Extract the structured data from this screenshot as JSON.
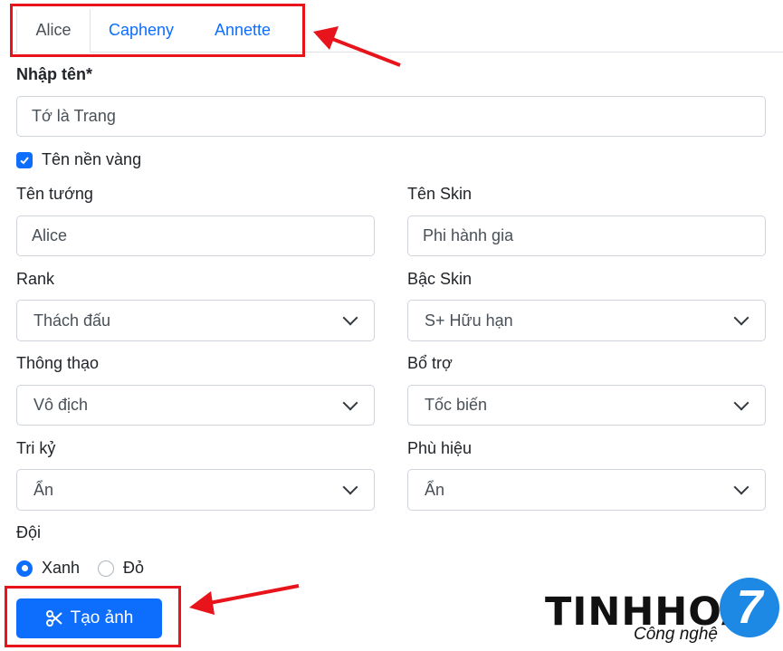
{
  "tabs": [
    {
      "label": "Alice",
      "active": true
    },
    {
      "label": "Capheny",
      "active": false
    },
    {
      "label": "Annette",
      "active": false
    }
  ],
  "name_field": {
    "label": "Nhập tên*",
    "value": "Tớ là Trang"
  },
  "gold_name": {
    "label": "Tên nền vàng",
    "checked": true
  },
  "hero": {
    "label": "Tên tướng",
    "value": "Alice"
  },
  "skin_name": {
    "label": "Tên Skin",
    "value": "Phi hành gia"
  },
  "rank": {
    "label": "Rank",
    "selected": "Thách đấu"
  },
  "skin_tier": {
    "label": "Bậc Skin",
    "selected": "S+ Hữu hạn"
  },
  "mastery": {
    "label": "Thông thạo",
    "selected": "Vô địch"
  },
  "spell": {
    "label": "Bổ trợ",
    "selected": "Tốc biến"
  },
  "soulmate": {
    "label": "Tri kỷ",
    "selected": "Ẩn"
  },
  "badge": {
    "label": "Phù hiệu",
    "selected": "Ẩn"
  },
  "team": {
    "label": "Đội",
    "options": [
      "Xanh",
      "Đỏ"
    ],
    "selected": "Xanh"
  },
  "create_button": {
    "label": "Tạo ảnh"
  },
  "watermark": {
    "brand": "TINHHOA",
    "tagline": "Công nghệ",
    "number": "7"
  },
  "colors": {
    "primary": "#0d6efd",
    "annotation_red": "#e8141b",
    "watermark_blue": "#1e88e5"
  }
}
